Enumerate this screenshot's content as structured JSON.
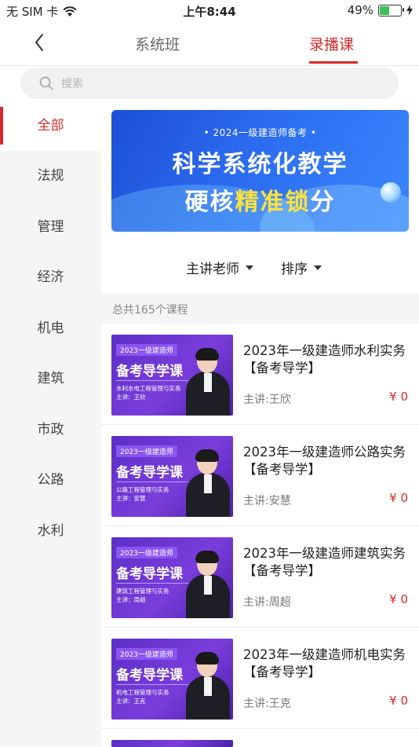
{
  "status_bar": {
    "carrier": "无 SIM 卡",
    "time": "上午8:44",
    "battery_percent": "49%",
    "battery_level": 0.49
  },
  "nav": {
    "tabs": [
      "系统班",
      "录播课"
    ],
    "active_tab": "录播课"
  },
  "search": {
    "placeholder": "搜索"
  },
  "sidebar": {
    "items": [
      "全部",
      "法规",
      "管理",
      "经济",
      "机电",
      "建筑",
      "市政",
      "公路",
      "水利"
    ],
    "active": "全部"
  },
  "banner": {
    "subtitle": "• 2024一级建造师备考 •",
    "line1": "科学系统化教学",
    "line2_plain": "硬核",
    "line2_highlight": "精准锁",
    "line2_end": "分",
    "accent_color": "#ffe23b"
  },
  "filters": {
    "teacher": "主讲老师",
    "sort": "排序"
  },
  "course_count": "总共165个课程",
  "courses": [
    {
      "thumb_tag": "2023一级建造师",
      "thumb_title": "备考导学课",
      "thumb_subject": "水利水电工程管理与实务",
      "thumb_teacher": "主讲：王欣",
      "title": "2023年一级建造师水利实务【备考导学】",
      "teacher": "主讲:王欣",
      "price": "¥ 0"
    },
    {
      "thumb_tag": "2023一级建造师",
      "thumb_title": "备考导学课",
      "thumb_subject": "公路工程管理与实务",
      "thumb_teacher": "主讲：安慧",
      "title": "2023年一级建造师公路实务【备考导学】",
      "teacher": "主讲:安慧",
      "price": "¥ 0"
    },
    {
      "thumb_tag": "2023一级建造师",
      "thumb_title": "备考导学课",
      "thumb_subject": "建筑工程管理与实务",
      "thumb_teacher": "主讲：周超",
      "title": "2023年一级建造师建筑实务【备考导学】",
      "teacher": "主讲:周超",
      "price": "¥ 0"
    },
    {
      "thumb_tag": "2023一级建造师",
      "thumb_title": "备考导学课",
      "thumb_subject": "机电工程管理与实务",
      "thumb_teacher": "主讲：王克",
      "title": "2023年一级建造师机电实务【备考导学】",
      "teacher": "主讲:王克",
      "price": "¥ 0"
    }
  ],
  "colors": {
    "primary": "#d52b2b",
    "sidebar_bg": "#f5f5f5",
    "thumb_purple": "#6a35d0"
  }
}
